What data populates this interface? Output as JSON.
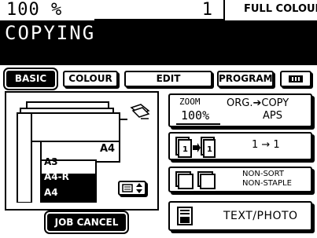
{
  "status": {
    "zoom_percent": "100  %",
    "copies": "1",
    "color_mode": "FULL COLOUR",
    "state": "COPYING"
  },
  "tabs": [
    {
      "label": "BASIC",
      "active": true
    },
    {
      "label": "COLOUR",
      "active": false
    },
    {
      "label": "EDIT",
      "active": false
    },
    {
      "label": "PROGRAM",
      "active": false
    },
    {
      "label": "",
      "icon": "keyboard-icon",
      "active": false
    }
  ],
  "paper": {
    "bypass_size": "A4",
    "trays": [
      "A3",
      "A4-R",
      "A4"
    ],
    "selected_tray_index": 2
  },
  "zoom": {
    "label": "ZOOM",
    "value": "100%",
    "org_copy": "ORG.➔COPY",
    "aps": "APS"
  },
  "duplex": {
    "value": "1 → 1"
  },
  "finishing": {
    "line1": "NON-SORT",
    "line2": "NON-STAPLE"
  },
  "original_mode": {
    "value": "TEXT/PHOTO"
  },
  "job_cancel": {
    "label": "JOB CANCEL"
  }
}
